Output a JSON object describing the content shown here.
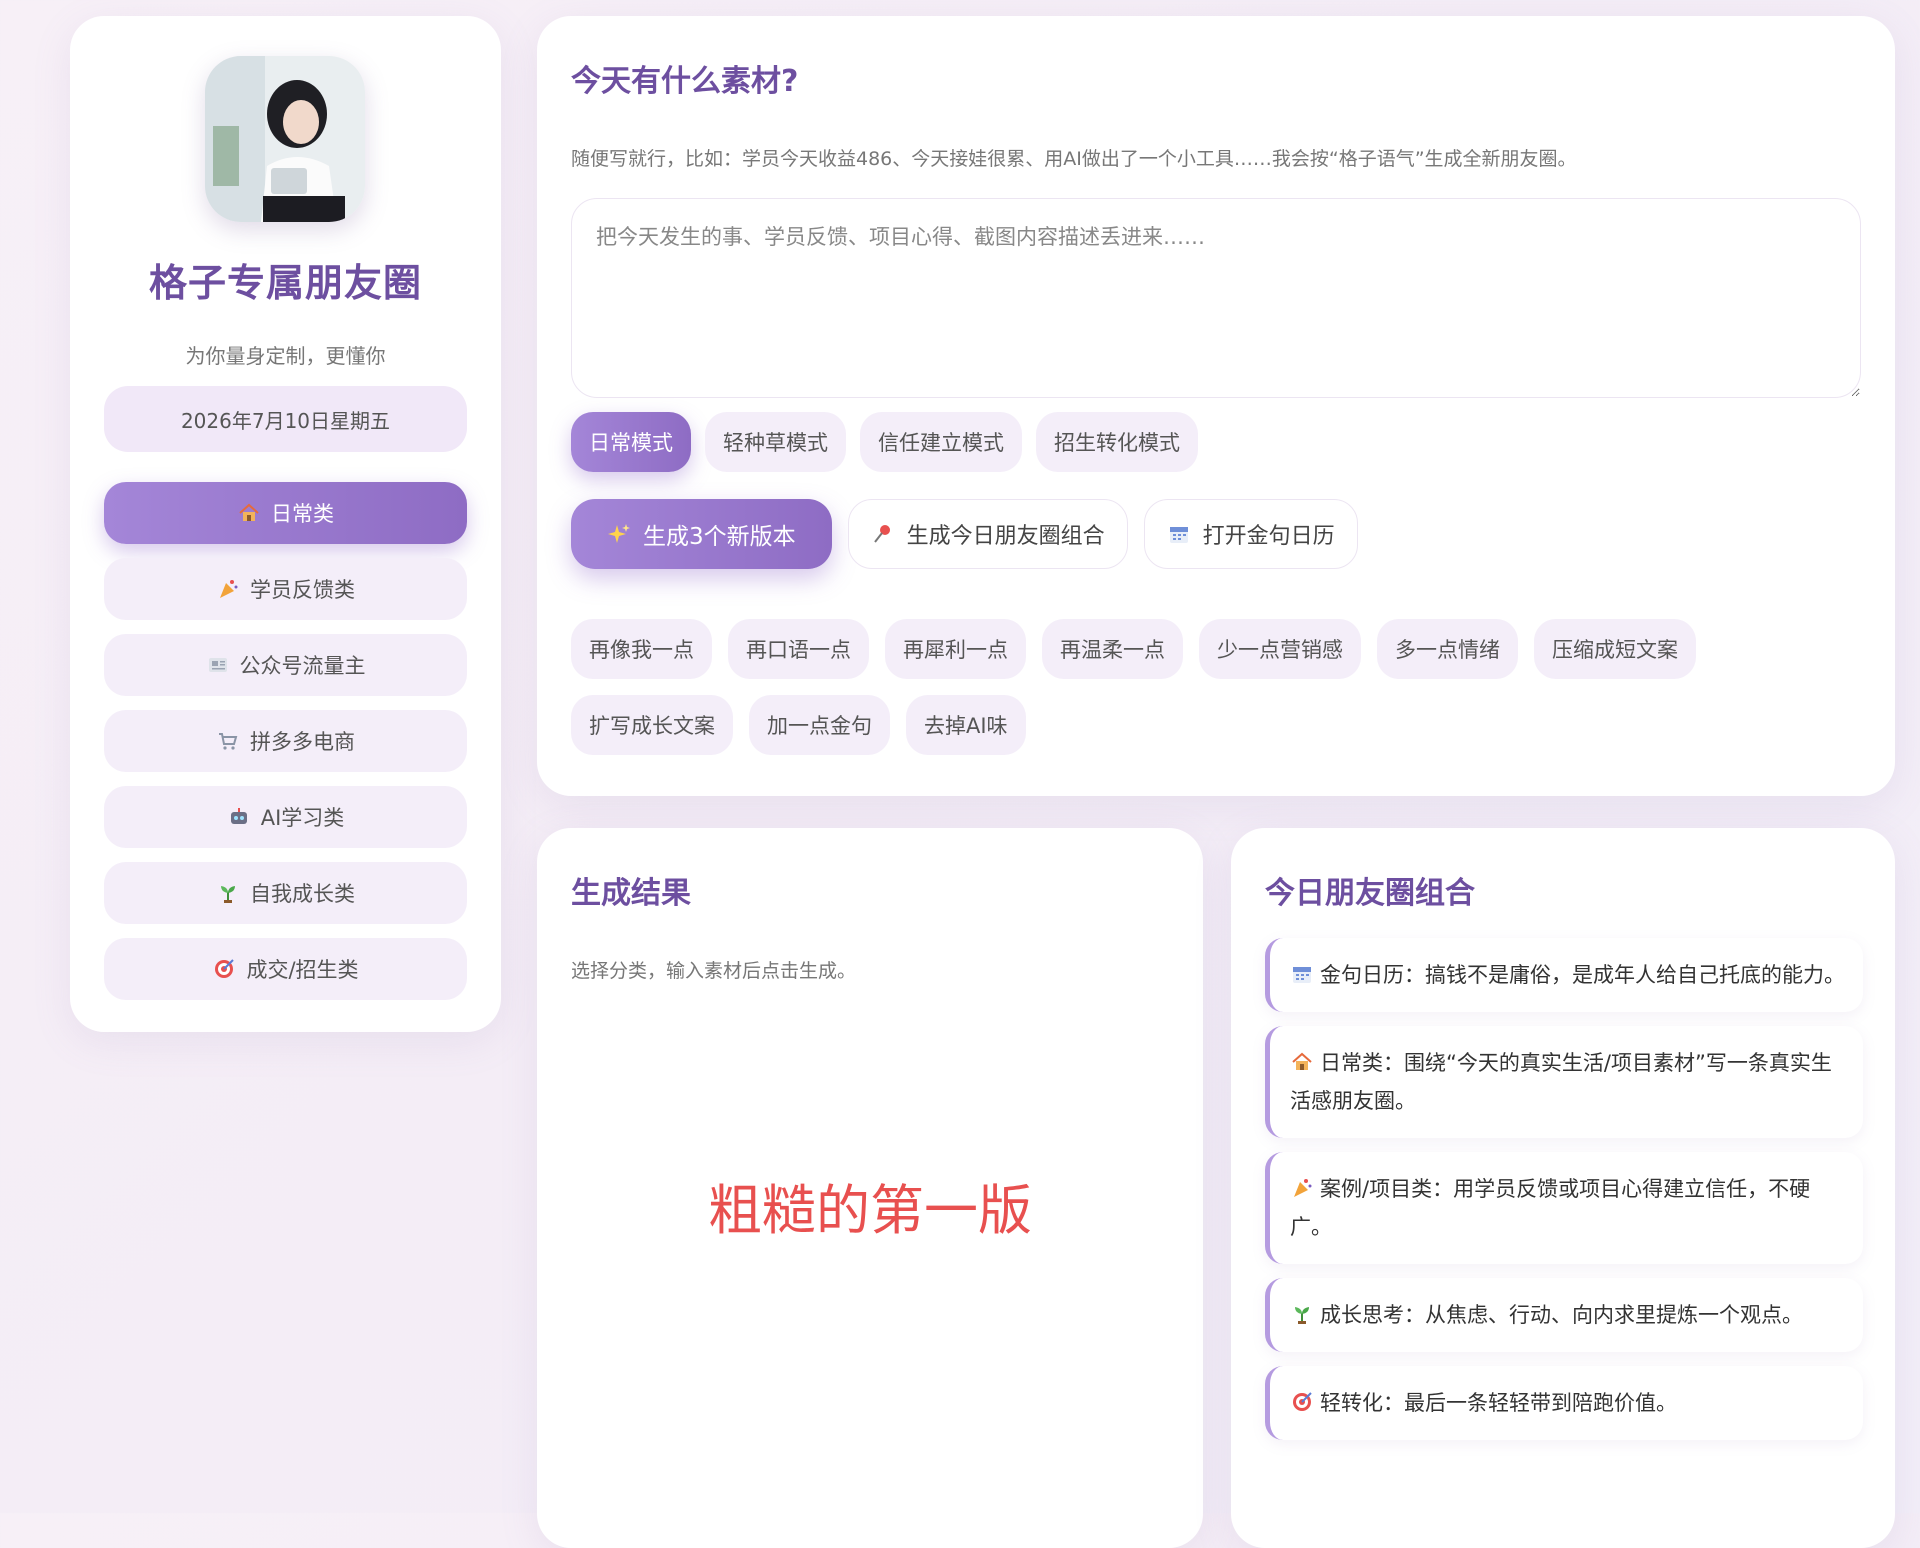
{
  "sidebar": {
    "title": "格子专属朋友圈",
    "subtitle": "为你量身定制，更懂你",
    "date": "2026年7月10日星期五",
    "categories": [
      {
        "label": "日常类",
        "icon": "house-icon",
        "active": true
      },
      {
        "label": "学员反馈类",
        "icon": "party-popper-icon",
        "active": false
      },
      {
        "label": "公众号流量主",
        "icon": "newspaper-icon",
        "active": false
      },
      {
        "label": "拼多多电商",
        "icon": "shopping-cart-icon",
        "active": false
      },
      {
        "label": "AI学习类",
        "icon": "robot-icon",
        "active": false
      },
      {
        "label": "自我成长类",
        "icon": "seedling-icon",
        "active": false
      },
      {
        "label": "成交/招生类",
        "icon": "target-icon",
        "active": false
      }
    ]
  },
  "input_panel": {
    "title": "今天有什么素材?",
    "hint": "随便写就行，比如：学员今天收益486、今天接娃很累、用AI做出了一个小工具……我会按“格子语气”生成全新朋友圈。",
    "placeholder": "把今天发生的事、学员反馈、项目心得、截图内容描述丢进来……",
    "value": "",
    "modes": [
      {
        "label": "日常模式",
        "active": true
      },
      {
        "label": "轻种草模式",
        "active": false
      },
      {
        "label": "信任建立模式",
        "active": false
      },
      {
        "label": "招生转化模式",
        "active": false
      }
    ],
    "actions": {
      "generate": {
        "label": "生成3个新版本",
        "icon": "sparkles-icon"
      },
      "combo": {
        "label": "生成今日朋友圈组合",
        "icon": "pushpin-icon"
      },
      "calendar": {
        "label": "打开金句日历",
        "icon": "calendar-icon"
      }
    },
    "tweaks": [
      "再像我一点",
      "再口语一点",
      "再犀利一点",
      "再温柔一点",
      "少一点营销感",
      "多一点情绪",
      "压缩成短文案",
      "扩写成长文案",
      "加一点金句",
      "去掉AI味"
    ]
  },
  "result_panel": {
    "title": "生成结果",
    "hint": "选择分类，输入素材后点击生成。",
    "draft_label": "粗糙的第一版"
  },
  "combo_panel": {
    "title": "今日朋友圈组合",
    "items": [
      {
        "icon": "calendar-icon",
        "text": "金句日历：搞钱不是庸俗，是成年人给自己托底的能力。"
      },
      {
        "icon": "house-icon",
        "text": "日常类：围绕“今天的真实生活/项目素材”写一条真实生活感朋友圈。"
      },
      {
        "icon": "party-popper-icon",
        "text": "案例/项目类：用学员反馈或项目心得建立信任，不硬广。"
      },
      {
        "icon": "seedling-icon",
        "text": "成长思考：从焦虑、行动、向内求里提炼一个观点。"
      },
      {
        "icon": "target-icon",
        "text": "轻转化：最后一条轻轻带到陪跑价值。"
      }
    ]
  },
  "colors": {
    "accent": "#8e6cc4",
    "accent_light": "#a486d8",
    "title_purple": "#6d4fa0",
    "chip_bg": "#f4eef9",
    "draft_red": "#e8504f"
  }
}
